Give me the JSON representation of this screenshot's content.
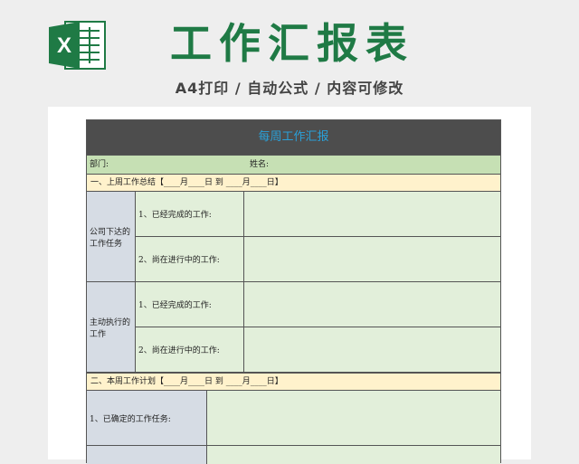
{
  "banner": {
    "title": "工作汇报表",
    "subtitle": "A4打印 / 自动公式 / 内容可修改",
    "logo_icon": "excel-icon",
    "logo_letter": "X",
    "brand_color": "#1f7a45"
  },
  "sheet": {
    "title": "每周工作汇报",
    "dept_label": "部门:",
    "name_label": "姓名:",
    "section1": "一、上周工作总结【____月____日 到 ____月____日】",
    "group1_label": "公司下达的工作任务",
    "group2_label": "主动执行的工作",
    "completed_label": "1、已经完成的工作:",
    "in_progress_label": "2、尚在进行中的工作:",
    "section2": "二、本周工作计划【____月____日 到 ____月____日】",
    "confirmed_label": "1、已确定的工作任务:"
  }
}
